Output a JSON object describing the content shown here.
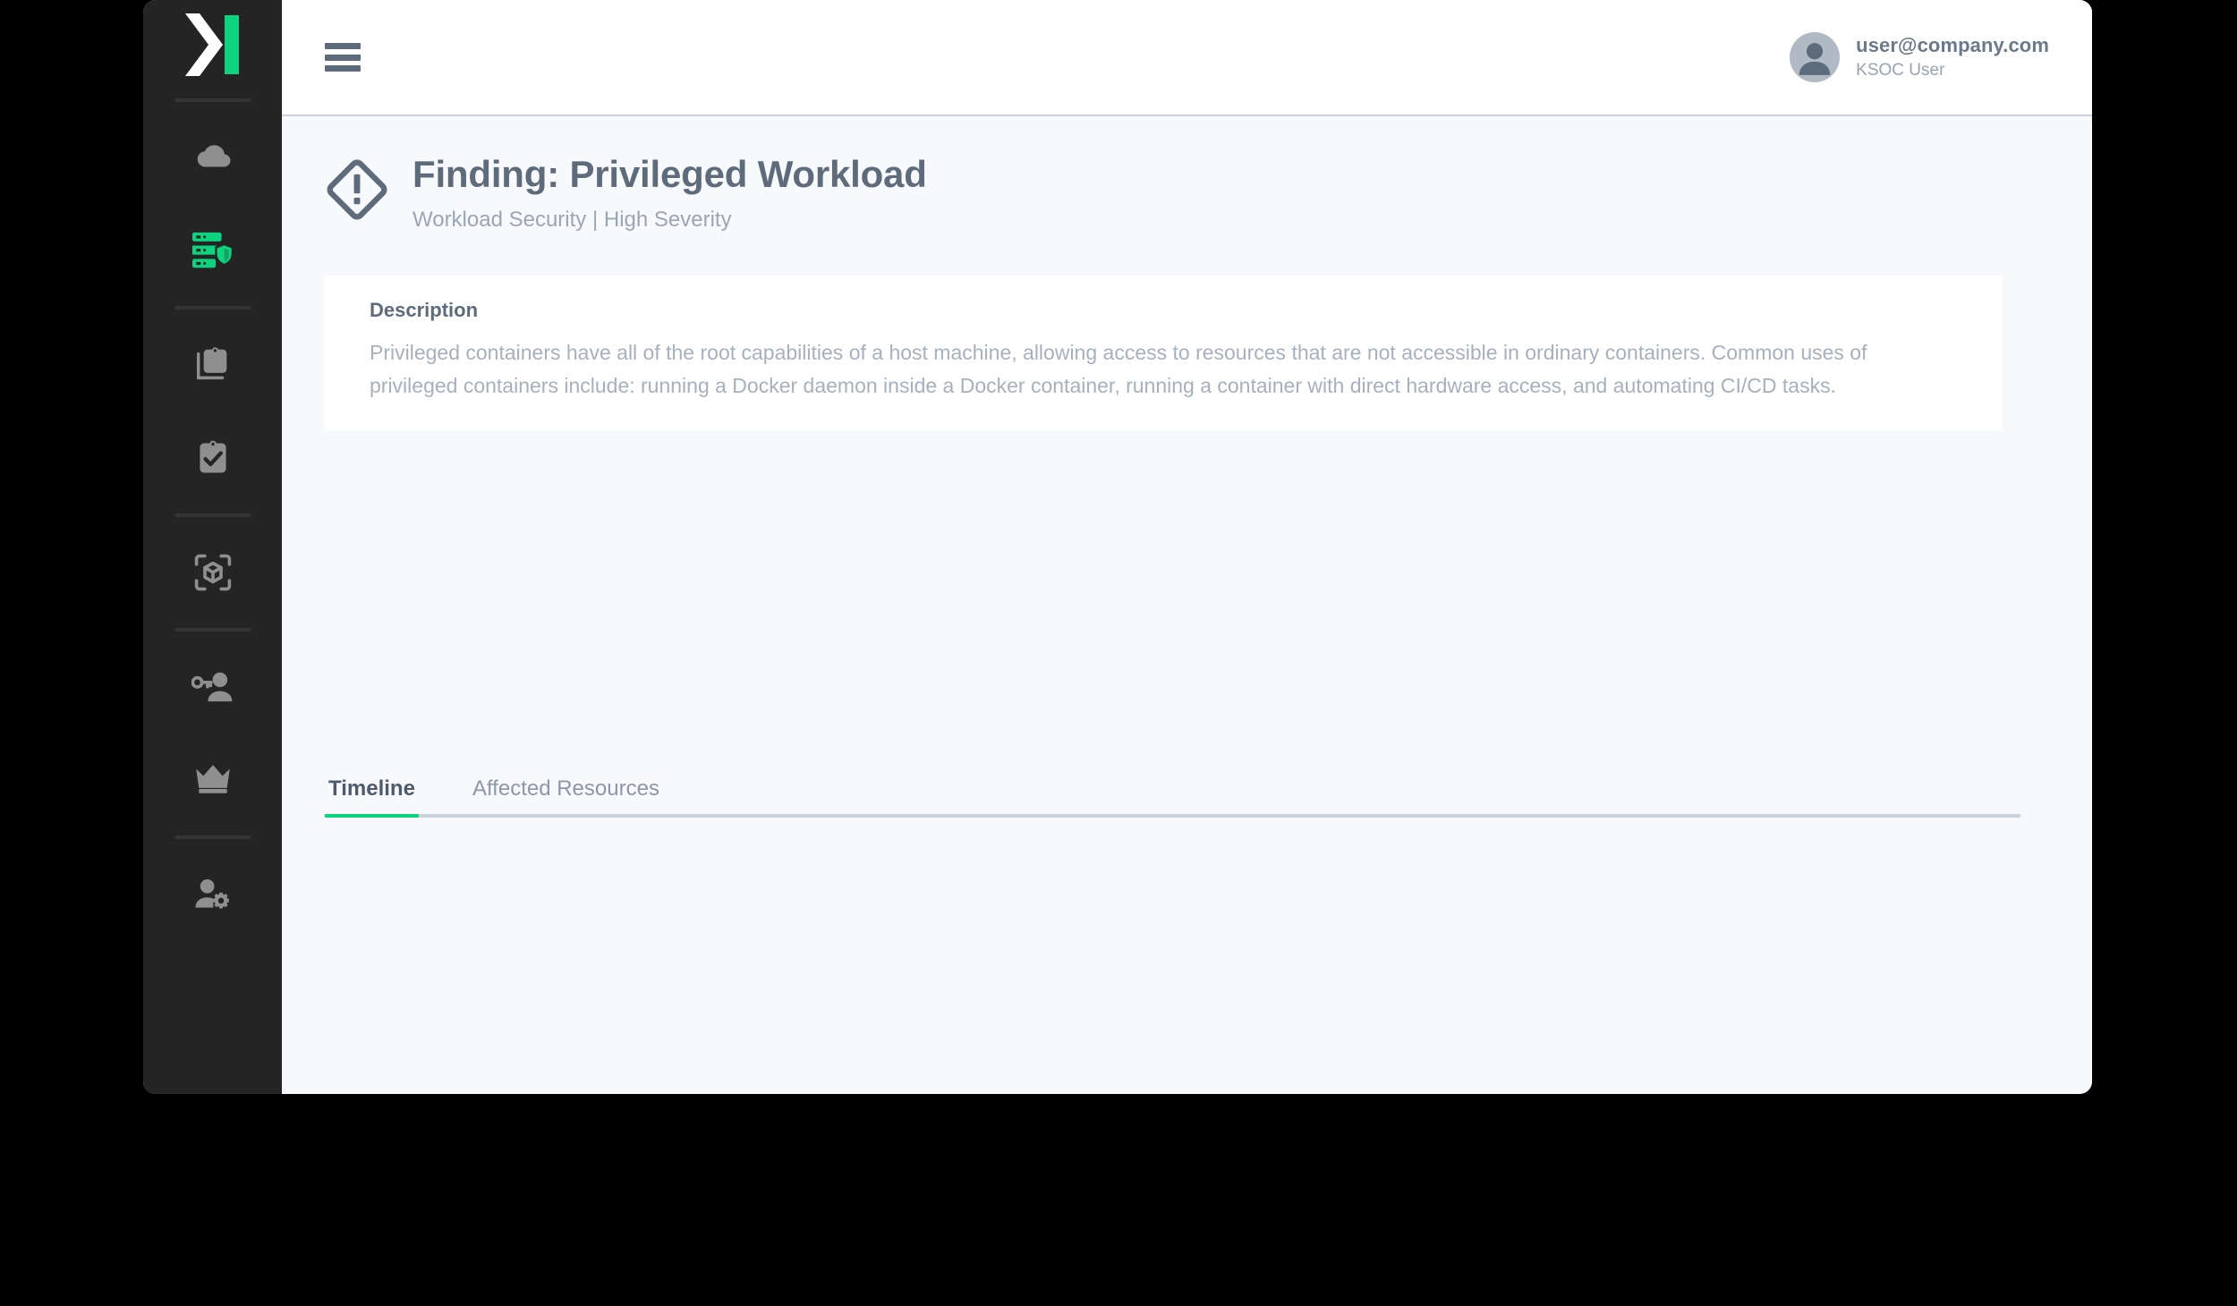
{
  "theme": {
    "accent_green": "#0ed37e",
    "sidebar_bg": "#242424",
    "page_bg": "#f7f9fc",
    "header_bg": "#ffffff",
    "text_slate": "#5d6b7a",
    "text_muted": "#a6b1bd"
  },
  "sidebar": {
    "logo_name": "ksoc-logo",
    "groups": [
      {
        "items": [
          {
            "icon": "cloud-icon",
            "name": "sidebar-item-cloud",
            "active": false
          },
          {
            "icon": "server-shield-icon",
            "name": "sidebar-item-workload-security",
            "active": true
          }
        ]
      },
      {
        "items": [
          {
            "icon": "clipboard-stack-icon",
            "name": "sidebar-item-policies",
            "active": false
          },
          {
            "icon": "clipboard-check-icon",
            "name": "sidebar-item-compliance",
            "active": false
          }
        ]
      },
      {
        "items": [
          {
            "icon": "cube-scan-icon",
            "name": "sidebar-item-registry-scan",
            "active": false
          }
        ]
      },
      {
        "items": [
          {
            "icon": "user-key-icon",
            "name": "sidebar-item-identity",
            "active": false
          },
          {
            "icon": "crown-icon",
            "name": "sidebar-item-privileges",
            "active": false
          }
        ]
      },
      {
        "items": [
          {
            "icon": "user-gear-icon",
            "name": "sidebar-item-admin-settings",
            "active": false
          }
        ]
      }
    ]
  },
  "header": {
    "menu_icon": "hamburger-menu-icon",
    "avatar_icon": "user-avatar-icon",
    "user_email": "user@company.com",
    "user_role": "KSOC User"
  },
  "page": {
    "status_icon": "alert-diamond-icon",
    "title": "Finding: Privileged Workload",
    "subtitle": "Workload Security | High Severity"
  },
  "description_card": {
    "heading": "Description",
    "body": "Privileged containers have all of the root capabilities of a host machine, allowing access to resources that are not accessible in ordinary containers. Common uses of privileged containers include: running a Docker daemon inside a Docker container, running a container with direct hardware access, and automating CI/CD tasks."
  },
  "tabs": {
    "items": [
      {
        "label": "Timeline",
        "name": "tab-timeline",
        "active": true
      },
      {
        "label": "Affected Resources",
        "name": "tab-affected-resources",
        "active": false
      }
    ]
  }
}
